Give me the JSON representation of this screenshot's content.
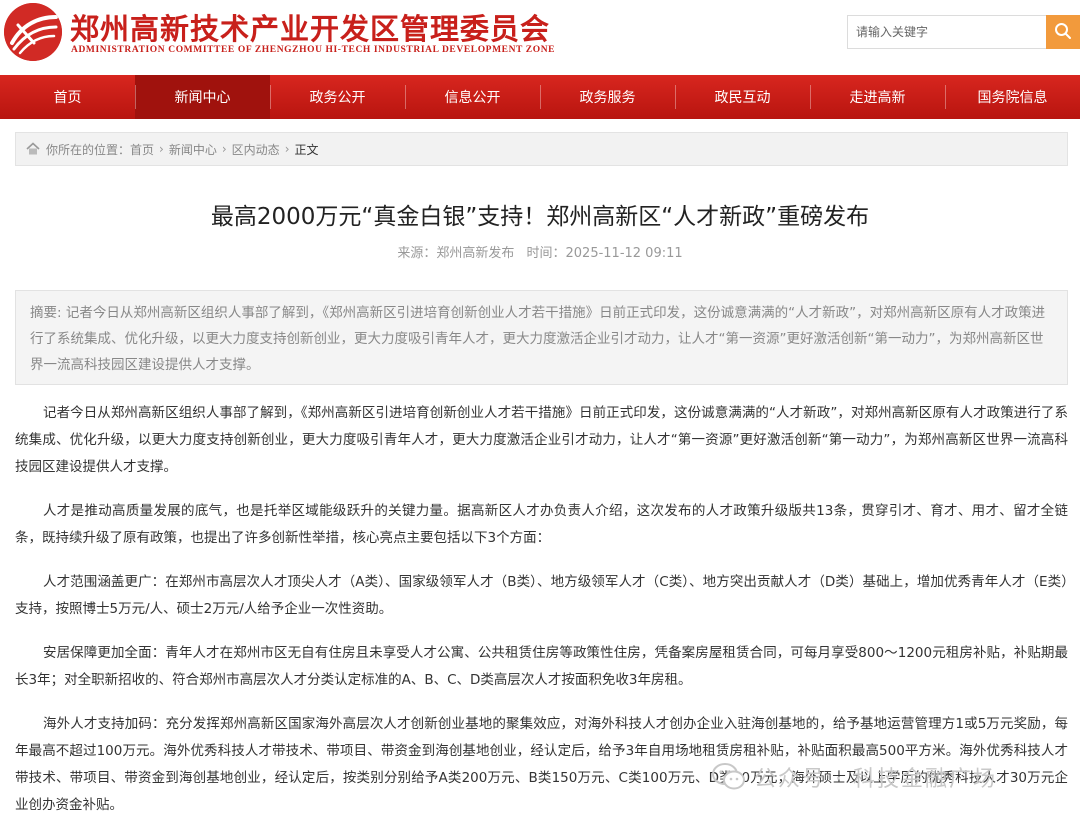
{
  "header": {
    "title": "郑州高新技术产业开发区管理委员会",
    "subtitle": "ADMINISTRATION COMMITTEE OF ZHENGZHOU HI-TECH INDUSTRIAL DEVELOPMENT ZONE",
    "logo_icon": "red-circle-emblem-icon",
    "brand_color": "#c8201b"
  },
  "search": {
    "placeholder": "请输入关键字",
    "button_icon": "search-icon",
    "button_color": "#f29a3c"
  },
  "nav": {
    "items": [
      {
        "label": "首页"
      },
      {
        "label": "新闻中心"
      },
      {
        "label": "政务公开"
      },
      {
        "label": "信息公开"
      },
      {
        "label": "政务服务"
      },
      {
        "label": "政民互动"
      },
      {
        "label": "走进高新"
      },
      {
        "label": "国务院信息"
      }
    ],
    "active": "新闻中心",
    "color": "#c81d17"
  },
  "breadcrumb": {
    "icon": "home-icon",
    "prefix": "你所在的位置：",
    "items": [
      "首页",
      "新闻中心",
      "区内动态"
    ],
    "separator": "›",
    "current": "正文"
  },
  "article": {
    "title": "最高2000万元“真金白银”支持！郑州高新区“人才新政”重磅发布",
    "source": "来源：郑州高新发布",
    "time": "时间：2025-11-12 09:11",
    "summary": "摘要: 记者今日从郑州高新区组织人事部了解到，《郑州高新区引进培育创新创业人才若干措施》日前正式印发，这份诚意满满的“人才新政”，对郑州高新区原有人才政策进行了系统集成、优化升级，以更大力度支持创新创业，更大力度吸引青年人才，更大力度激活企业引才动力，让人才“第一资源”更好激活创新“第一动力”，为郑州高新区世界一流高科技园区建设提供人才支撑。",
    "paragraphs": [
      "记者今日从郑州高新区组织人事部了解到，《郑州高新区引进培育创新创业人才若干措施》日前正式印发，这份诚意满满的“人才新政”，对郑州高新区原有人才政策进行了系统集成、优化升级，以更大力度支持创新创业，更大力度吸引青年人才，更大力度激活企业引才动力，让人才“第一资源”更好激活创新“第一动力”，为郑州高新区世界一流高科技园区建设提供人才支撑。",
      "人才是推动高质量发展的底气，也是托举区域能级跃升的关键力量。据高新区人才办负责人介绍，这次发布的人才政策升级版共13条，贯穿引才、育才、用才、留才全链条，既持续升级了原有政策，也提出了许多创新性举措，核心亮点主要包括以下3个方面：",
      "人才范围涵盖更广：在郑州市高层次人才顶尖人才（A类）、国家级领军人才（B类）、地方级领军人才（C类）、地方突出贡献人才（D类）基础上，增加优秀青年人才（E类）支持，按照博士5万元/人、硕士2万元/人给予企业一次性资助。",
      "安居保障更加全面：青年人才在郑州市区无自有住房且未享受人才公寓、公共租赁住房等政策性住房，凭备案房屋租赁合同，可每月享受800～1200元租房补贴，补贴期最长3年；对全职新招收的、符合郑州市高层次人才分类认定标准的A、B、C、D类高层次人才按面积免收3年房租。",
      "海外人才支持加码：充分发挥郑州高新区国家海外高层次人才创新创业基地的聚集效应，对海外科技人才创办企业入驻海创基地的，给予基地运营管理方1或5万元奖励，每年最高不超过100万元。海外优秀科技人才带技术、带项目、带资金到海创基地创业，经认定后，给予3年自用场地租赁房租补贴，补贴面积最高500平方米。海外优秀科技人才带技术、带项目、带资金到海创基地创业，经认定后，按类别分别给予A类200万元、B类150万元、C类100万元、D类50万元，海外硕士及以上学历的优秀科技人才30万元企业创办资金补贴。"
    ]
  },
  "watermark": {
    "icon": "wechat-icon",
    "text": "公众号 · 科技金融广场"
  }
}
